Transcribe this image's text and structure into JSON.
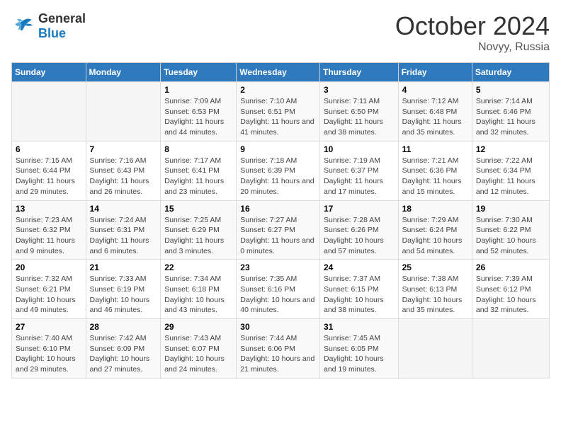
{
  "header": {
    "logo_general": "General",
    "logo_blue": "Blue",
    "month_title": "October 2024",
    "location": "Novyy, Russia"
  },
  "days_of_week": [
    "Sunday",
    "Monday",
    "Tuesday",
    "Wednesday",
    "Thursday",
    "Friday",
    "Saturday"
  ],
  "weeks": [
    [
      {
        "day": "",
        "info": ""
      },
      {
        "day": "",
        "info": ""
      },
      {
        "day": "1",
        "sunrise": "Sunrise: 7:09 AM",
        "sunset": "Sunset: 6:53 PM",
        "daylight": "Daylight: 11 hours and 44 minutes."
      },
      {
        "day": "2",
        "sunrise": "Sunrise: 7:10 AM",
        "sunset": "Sunset: 6:51 PM",
        "daylight": "Daylight: 11 hours and 41 minutes."
      },
      {
        "day": "3",
        "sunrise": "Sunrise: 7:11 AM",
        "sunset": "Sunset: 6:50 PM",
        "daylight": "Daylight: 11 hours and 38 minutes."
      },
      {
        "day": "4",
        "sunrise": "Sunrise: 7:12 AM",
        "sunset": "Sunset: 6:48 PM",
        "daylight": "Daylight: 11 hours and 35 minutes."
      },
      {
        "day": "5",
        "sunrise": "Sunrise: 7:14 AM",
        "sunset": "Sunset: 6:46 PM",
        "daylight": "Daylight: 11 hours and 32 minutes."
      }
    ],
    [
      {
        "day": "6",
        "sunrise": "Sunrise: 7:15 AM",
        "sunset": "Sunset: 6:44 PM",
        "daylight": "Daylight: 11 hours and 29 minutes."
      },
      {
        "day": "7",
        "sunrise": "Sunrise: 7:16 AM",
        "sunset": "Sunset: 6:43 PM",
        "daylight": "Daylight: 11 hours and 26 minutes."
      },
      {
        "day": "8",
        "sunrise": "Sunrise: 7:17 AM",
        "sunset": "Sunset: 6:41 PM",
        "daylight": "Daylight: 11 hours and 23 minutes."
      },
      {
        "day": "9",
        "sunrise": "Sunrise: 7:18 AM",
        "sunset": "Sunset: 6:39 PM",
        "daylight": "Daylight: 11 hours and 20 minutes."
      },
      {
        "day": "10",
        "sunrise": "Sunrise: 7:19 AM",
        "sunset": "Sunset: 6:37 PM",
        "daylight": "Daylight: 11 hours and 17 minutes."
      },
      {
        "day": "11",
        "sunrise": "Sunrise: 7:21 AM",
        "sunset": "Sunset: 6:36 PM",
        "daylight": "Daylight: 11 hours and 15 minutes."
      },
      {
        "day": "12",
        "sunrise": "Sunrise: 7:22 AM",
        "sunset": "Sunset: 6:34 PM",
        "daylight": "Daylight: 11 hours and 12 minutes."
      }
    ],
    [
      {
        "day": "13",
        "sunrise": "Sunrise: 7:23 AM",
        "sunset": "Sunset: 6:32 PM",
        "daylight": "Daylight: 11 hours and 9 minutes."
      },
      {
        "day": "14",
        "sunrise": "Sunrise: 7:24 AM",
        "sunset": "Sunset: 6:31 PM",
        "daylight": "Daylight: 11 hours and 6 minutes."
      },
      {
        "day": "15",
        "sunrise": "Sunrise: 7:25 AM",
        "sunset": "Sunset: 6:29 PM",
        "daylight": "Daylight: 11 hours and 3 minutes."
      },
      {
        "day": "16",
        "sunrise": "Sunrise: 7:27 AM",
        "sunset": "Sunset: 6:27 PM",
        "daylight": "Daylight: 11 hours and 0 minutes."
      },
      {
        "day": "17",
        "sunrise": "Sunrise: 7:28 AM",
        "sunset": "Sunset: 6:26 PM",
        "daylight": "Daylight: 10 hours and 57 minutes."
      },
      {
        "day": "18",
        "sunrise": "Sunrise: 7:29 AM",
        "sunset": "Sunset: 6:24 PM",
        "daylight": "Daylight: 10 hours and 54 minutes."
      },
      {
        "day": "19",
        "sunrise": "Sunrise: 7:30 AM",
        "sunset": "Sunset: 6:22 PM",
        "daylight": "Daylight: 10 hours and 52 minutes."
      }
    ],
    [
      {
        "day": "20",
        "sunrise": "Sunrise: 7:32 AM",
        "sunset": "Sunset: 6:21 PM",
        "daylight": "Daylight: 10 hours and 49 minutes."
      },
      {
        "day": "21",
        "sunrise": "Sunrise: 7:33 AM",
        "sunset": "Sunset: 6:19 PM",
        "daylight": "Daylight: 10 hours and 46 minutes."
      },
      {
        "day": "22",
        "sunrise": "Sunrise: 7:34 AM",
        "sunset": "Sunset: 6:18 PM",
        "daylight": "Daylight: 10 hours and 43 minutes."
      },
      {
        "day": "23",
        "sunrise": "Sunrise: 7:35 AM",
        "sunset": "Sunset: 6:16 PM",
        "daylight": "Daylight: 10 hours and 40 minutes."
      },
      {
        "day": "24",
        "sunrise": "Sunrise: 7:37 AM",
        "sunset": "Sunset: 6:15 PM",
        "daylight": "Daylight: 10 hours and 38 minutes."
      },
      {
        "day": "25",
        "sunrise": "Sunrise: 7:38 AM",
        "sunset": "Sunset: 6:13 PM",
        "daylight": "Daylight: 10 hours and 35 minutes."
      },
      {
        "day": "26",
        "sunrise": "Sunrise: 7:39 AM",
        "sunset": "Sunset: 6:12 PM",
        "daylight": "Daylight: 10 hours and 32 minutes."
      }
    ],
    [
      {
        "day": "27",
        "sunrise": "Sunrise: 7:40 AM",
        "sunset": "Sunset: 6:10 PM",
        "daylight": "Daylight: 10 hours and 29 minutes."
      },
      {
        "day": "28",
        "sunrise": "Sunrise: 7:42 AM",
        "sunset": "Sunset: 6:09 PM",
        "daylight": "Daylight: 10 hours and 27 minutes."
      },
      {
        "day": "29",
        "sunrise": "Sunrise: 7:43 AM",
        "sunset": "Sunset: 6:07 PM",
        "daylight": "Daylight: 10 hours and 24 minutes."
      },
      {
        "day": "30",
        "sunrise": "Sunrise: 7:44 AM",
        "sunset": "Sunset: 6:06 PM",
        "daylight": "Daylight: 10 hours and 21 minutes."
      },
      {
        "day": "31",
        "sunrise": "Sunrise: 7:45 AM",
        "sunset": "Sunset: 6:05 PM",
        "daylight": "Daylight: 10 hours and 19 minutes."
      },
      {
        "day": "",
        "info": ""
      },
      {
        "day": "",
        "info": ""
      }
    ]
  ]
}
